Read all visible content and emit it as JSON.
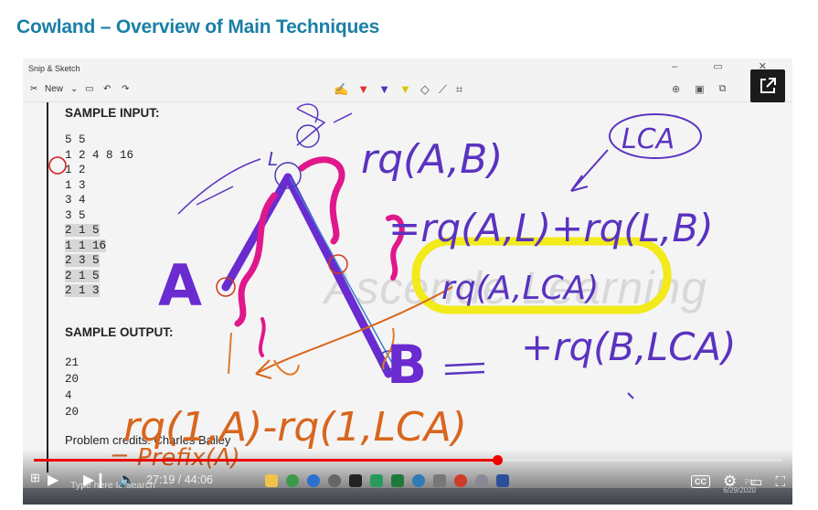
{
  "page_title": "Cowland – Overview of Main Techniques",
  "snip_window": {
    "app_title": "Snip & Sketch",
    "new_label": "New",
    "window_controls": "– ▭ ✕"
  },
  "code": {
    "sample_input_heading": "SAMPLE INPUT:",
    "input_lines": [
      "5 5",
      "1 2 4 8 16",
      "1 2",
      "1 3",
      "3 4",
      "3 5",
      "2 1 5",
      "1 1 16",
      "2 3 5",
      "2 1 5",
      "2 1 3"
    ],
    "sample_output_heading": "SAMPLE OUTPUT:",
    "output_lines": [
      "21",
      "20",
      "4",
      "20"
    ],
    "credits": "Problem credits: Charles Bailey"
  },
  "watermark": "Ascende Learning",
  "annotations": {
    "rq_ab": "rq(A,B)",
    "lca_circle": "LCA",
    "expansion": "=rq(A,L)+rq(L,B)",
    "rq_a_lca": "rq(A,LCA)",
    "rq_b_lca": "+rq(B,LCA)",
    "bottom_formula": "rq(1,A)-rq(1,LCA)",
    "prefix": "= Prefix(A)",
    "label_a": "A",
    "label_b": "B",
    "label_l": "L"
  },
  "player": {
    "current_time": "27:19",
    "duration": "44:06",
    "time_text": "27:19 / 44:06",
    "progress_fraction": 0.62,
    "search_hint": "Type here to search",
    "cc_label": "CC",
    "date_text": "6/29/2020",
    "time_small": "PM",
    "colors": {
      "progress": "#ee0000",
      "accent_title": "#1a7fa6"
    }
  }
}
